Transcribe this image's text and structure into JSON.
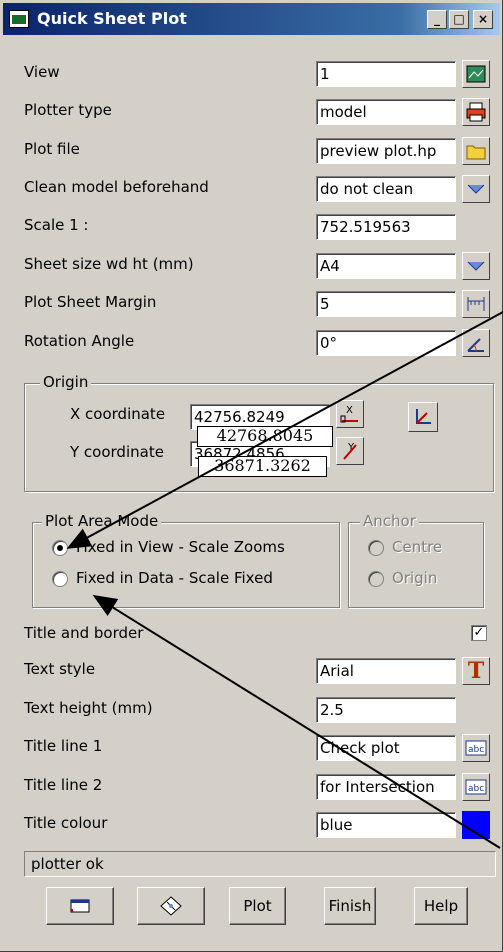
{
  "window": {
    "title": "Quick Sheet Plot"
  },
  "fields": [
    {
      "label": "View",
      "value": "1",
      "icon": "view-icon"
    },
    {
      "label": "Plotter type",
      "value": "model",
      "icon": "plotter-icon"
    },
    {
      "label": "Plot file",
      "value": "preview plot.hp",
      "icon": "folder-icon"
    },
    {
      "label": "Clean model beforehand",
      "value": "do not clean",
      "icon": "dropdown-icon"
    },
    {
      "label": "Scale 1 :",
      "value": "752.519563"
    },
    {
      "label": "Sheet size wd ht (mm)",
      "value": "A4",
      "icon": "dropdown-icon"
    },
    {
      "label": "Plot Sheet Margin",
      "value": "5",
      "icon": "margin-icon"
    },
    {
      "label": "Rotation Angle",
      "value": "0°",
      "icon": "rotation-icon"
    }
  ],
  "origin": {
    "label": "Origin",
    "x_label": "X coordinate",
    "x_value": "42756.8249",
    "y_label": "Y coordinate",
    "y_value": "36872.4856",
    "overlay_x": "42768.8045",
    "overlay_y": "36871.3262",
    "x_button": "X",
    "y_button": "Y"
  },
  "plot_area_mode": {
    "label": "Plot Area Mode",
    "options": [
      "Fixed in View - Scale Zooms",
      "Fixed in Data - Scale Fixed"
    ],
    "selected": 0
  },
  "anchor": {
    "label": "Anchor",
    "options": [
      "Centre",
      "Origin"
    ]
  },
  "title_border": {
    "label": "Title and border",
    "checked": true
  },
  "title_fields": [
    {
      "label": "Text style",
      "value": "Arial",
      "icon": "text-style-icon"
    },
    {
      "label": "Text height (mm)",
      "value": "2.5"
    },
    {
      "label": "Title line 1",
      "value": "Check plot",
      "icon": "abc-icon"
    },
    {
      "label": "Title line 2",
      "value": "for Intersection",
      "icon": "abc-icon"
    },
    {
      "label": "Title colour",
      "value": "blue",
      "icon": "colour-swatch",
      "swatch": "#0000ff"
    }
  ],
  "status": "plotter ok",
  "buttons": {
    "plot": "Plot",
    "finish": "Finish",
    "help": "Help"
  },
  "colors": {
    "titlebar": "#0a246a",
    "swatch": "#0000ff"
  }
}
